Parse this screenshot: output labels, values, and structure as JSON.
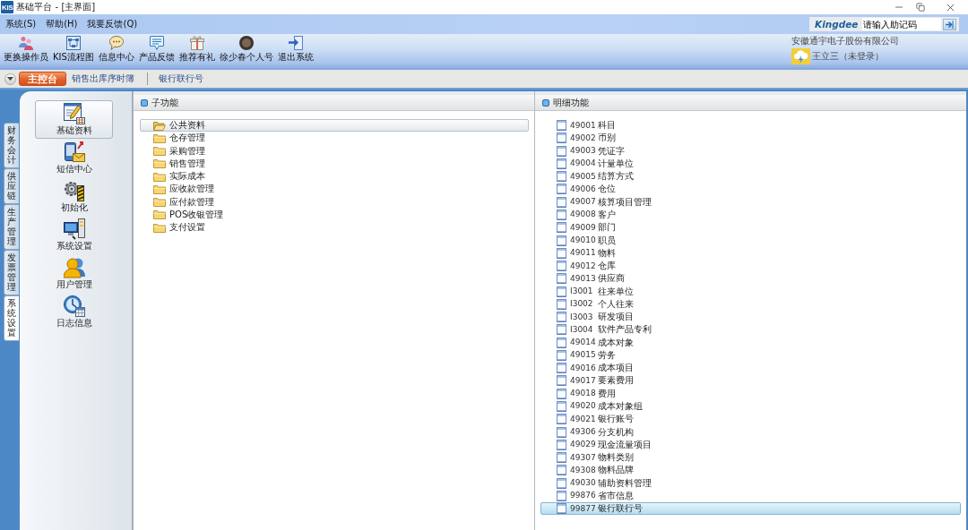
{
  "window": {
    "app_badge": "KIS",
    "title": "基础平台 - [主界面]"
  },
  "menu_bar": {
    "items": [
      "系统(S)",
      "帮助(H)",
      "我要反馈(Q)"
    ]
  },
  "quick_search": {
    "brand": "Kingdee",
    "placeholder": "请输入助记码"
  },
  "toolbar": {
    "buttons": [
      "更换操作员",
      "KIS流程图",
      "信息中心",
      "产品反馈",
      "推荐有礼",
      "徐少春个人号",
      "退出系统"
    ]
  },
  "account": {
    "company": "安徽通宇电子股份有限公司",
    "user": "王立三（未登录）"
  },
  "doc_tabs": [
    {
      "label": "主控台",
      "selected": true
    },
    {
      "label": "销售出库序时簿",
      "selected": false
    },
    {
      "label": "银行联行号",
      "selected": false
    }
  ],
  "module_tabs": [
    {
      "label": "财务会计",
      "selected": false
    },
    {
      "label": "供应链",
      "selected": false
    },
    {
      "label": "生产管理",
      "selected": false
    },
    {
      "label": "发票管理",
      "selected": false
    },
    {
      "label": "系统设置",
      "selected": true
    }
  ],
  "nav": {
    "items": [
      {
        "label": "基础资料",
        "selected": true
      },
      {
        "label": "短信中心",
        "selected": false
      },
      {
        "label": "初始化",
        "selected": false
      },
      {
        "label": "系统设置",
        "selected": false
      },
      {
        "label": "用户管理",
        "selected": false
      },
      {
        "label": "日志信息",
        "selected": false
      }
    ]
  },
  "sub_functions": {
    "title": "子功能",
    "items": [
      {
        "label": "公共资料",
        "selected": true
      },
      {
        "label": "仓存管理",
        "selected": false
      },
      {
        "label": "采购管理",
        "selected": false
      },
      {
        "label": "销售管理",
        "selected": false
      },
      {
        "label": "实际成本",
        "selected": false
      },
      {
        "label": "应收款管理",
        "selected": false
      },
      {
        "label": "应付款管理",
        "selected": false
      },
      {
        "label": "POS收银管理",
        "selected": false
      },
      {
        "label": "支付设置",
        "selected": false
      }
    ]
  },
  "details": {
    "title": "明细功能",
    "items": [
      {
        "code": "49001",
        "name": "科目",
        "selected": false
      },
      {
        "code": "49002",
        "name": "币别",
        "selected": false
      },
      {
        "code": "49003",
        "name": "凭证字",
        "selected": false
      },
      {
        "code": "49004",
        "name": "计量单位",
        "selected": false
      },
      {
        "code": "49005",
        "name": "结算方式",
        "selected": false
      },
      {
        "code": "49006",
        "name": "仓位",
        "selected": false
      },
      {
        "code": "49007",
        "name": "核算项目管理",
        "selected": false
      },
      {
        "code": "49008",
        "name": "客户",
        "selected": false
      },
      {
        "code": "49009",
        "name": "部门",
        "selected": false
      },
      {
        "code": "49010",
        "name": "职员",
        "selected": false
      },
      {
        "code": "49011",
        "name": "物料",
        "selected": false
      },
      {
        "code": "49012",
        "name": "仓库",
        "selected": false
      },
      {
        "code": "49013",
        "name": "供应商",
        "selected": false
      },
      {
        "code": "I3001",
        "name": "往来单位",
        "selected": false
      },
      {
        "code": "I3002",
        "name": "个人往来",
        "selected": false
      },
      {
        "code": "I3003",
        "name": "研发项目",
        "selected": false
      },
      {
        "code": "I3004",
        "name": "软件产品专利",
        "selected": false
      },
      {
        "code": "49014",
        "name": "成本对象",
        "selected": false
      },
      {
        "code": "49015",
        "name": "劳务",
        "selected": false
      },
      {
        "code": "49016",
        "name": "成本项目",
        "selected": false
      },
      {
        "code": "49017",
        "name": "要素费用",
        "selected": false
      },
      {
        "code": "49018",
        "name": "费用",
        "selected": false
      },
      {
        "code": "49020",
        "name": "成本对象组",
        "selected": false
      },
      {
        "code": "49021",
        "name": "银行账号",
        "selected": false
      },
      {
        "code": "49306",
        "name": "分支机构",
        "selected": false
      },
      {
        "code": "49029",
        "name": "现金流量项目",
        "selected": false
      },
      {
        "code": "49307",
        "name": "物料类别",
        "selected": false
      },
      {
        "code": "49308",
        "name": "物料品牌",
        "selected": false
      },
      {
        "code": "49030",
        "name": "辅助资料管理",
        "selected": false
      },
      {
        "code": "99876",
        "name": "省市信息",
        "selected": false
      },
      {
        "code": "99877",
        "name": "银行联行号",
        "selected": true
      }
    ]
  }
}
